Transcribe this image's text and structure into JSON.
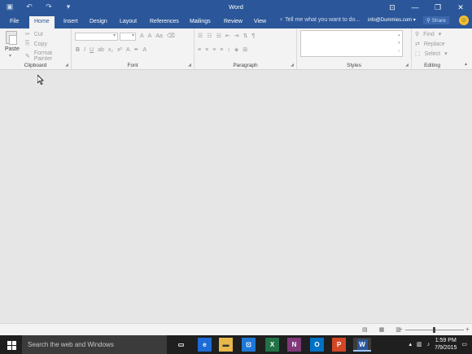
{
  "window": {
    "title": "Word"
  },
  "tabs": [
    "File",
    "Home",
    "Insert",
    "Design",
    "Layout",
    "References",
    "Mailings",
    "Review",
    "View"
  ],
  "tell_me": "Tell me what you want to do...",
  "account": "info@Dummies.com",
  "share": "Share",
  "clipboard": {
    "paste": "Paste",
    "cut": "Cut",
    "copy": "Copy",
    "format_painter": "Format Painter",
    "label": "Clipboard"
  },
  "font": {
    "label": "Font",
    "bold": "B",
    "italic": "I",
    "underline": "U",
    "grow": "A",
    "shrink": "A",
    "case": "Aa"
  },
  "paragraph": {
    "label": "Paragraph",
    "pilcrow": "¶"
  },
  "styles": {
    "label": "Styles"
  },
  "editing": {
    "find": "Find",
    "replace": "Replace",
    "select": "Select",
    "label": "Editing"
  },
  "taskbar": {
    "search_placeholder": "Search the web and Windows",
    "apps": [
      "task-view",
      "edge",
      "file-explorer",
      "store",
      "excel",
      "onenote",
      "outlook",
      "powerpoint",
      "word"
    ],
    "time": "1:59 PM",
    "date": "7/9/2015"
  },
  "colors": {
    "brand": "#2b579a",
    "ribbon": "#f3f3f3",
    "canvas": "#e6e6e6",
    "taskbar": "#1f1f1f"
  }
}
